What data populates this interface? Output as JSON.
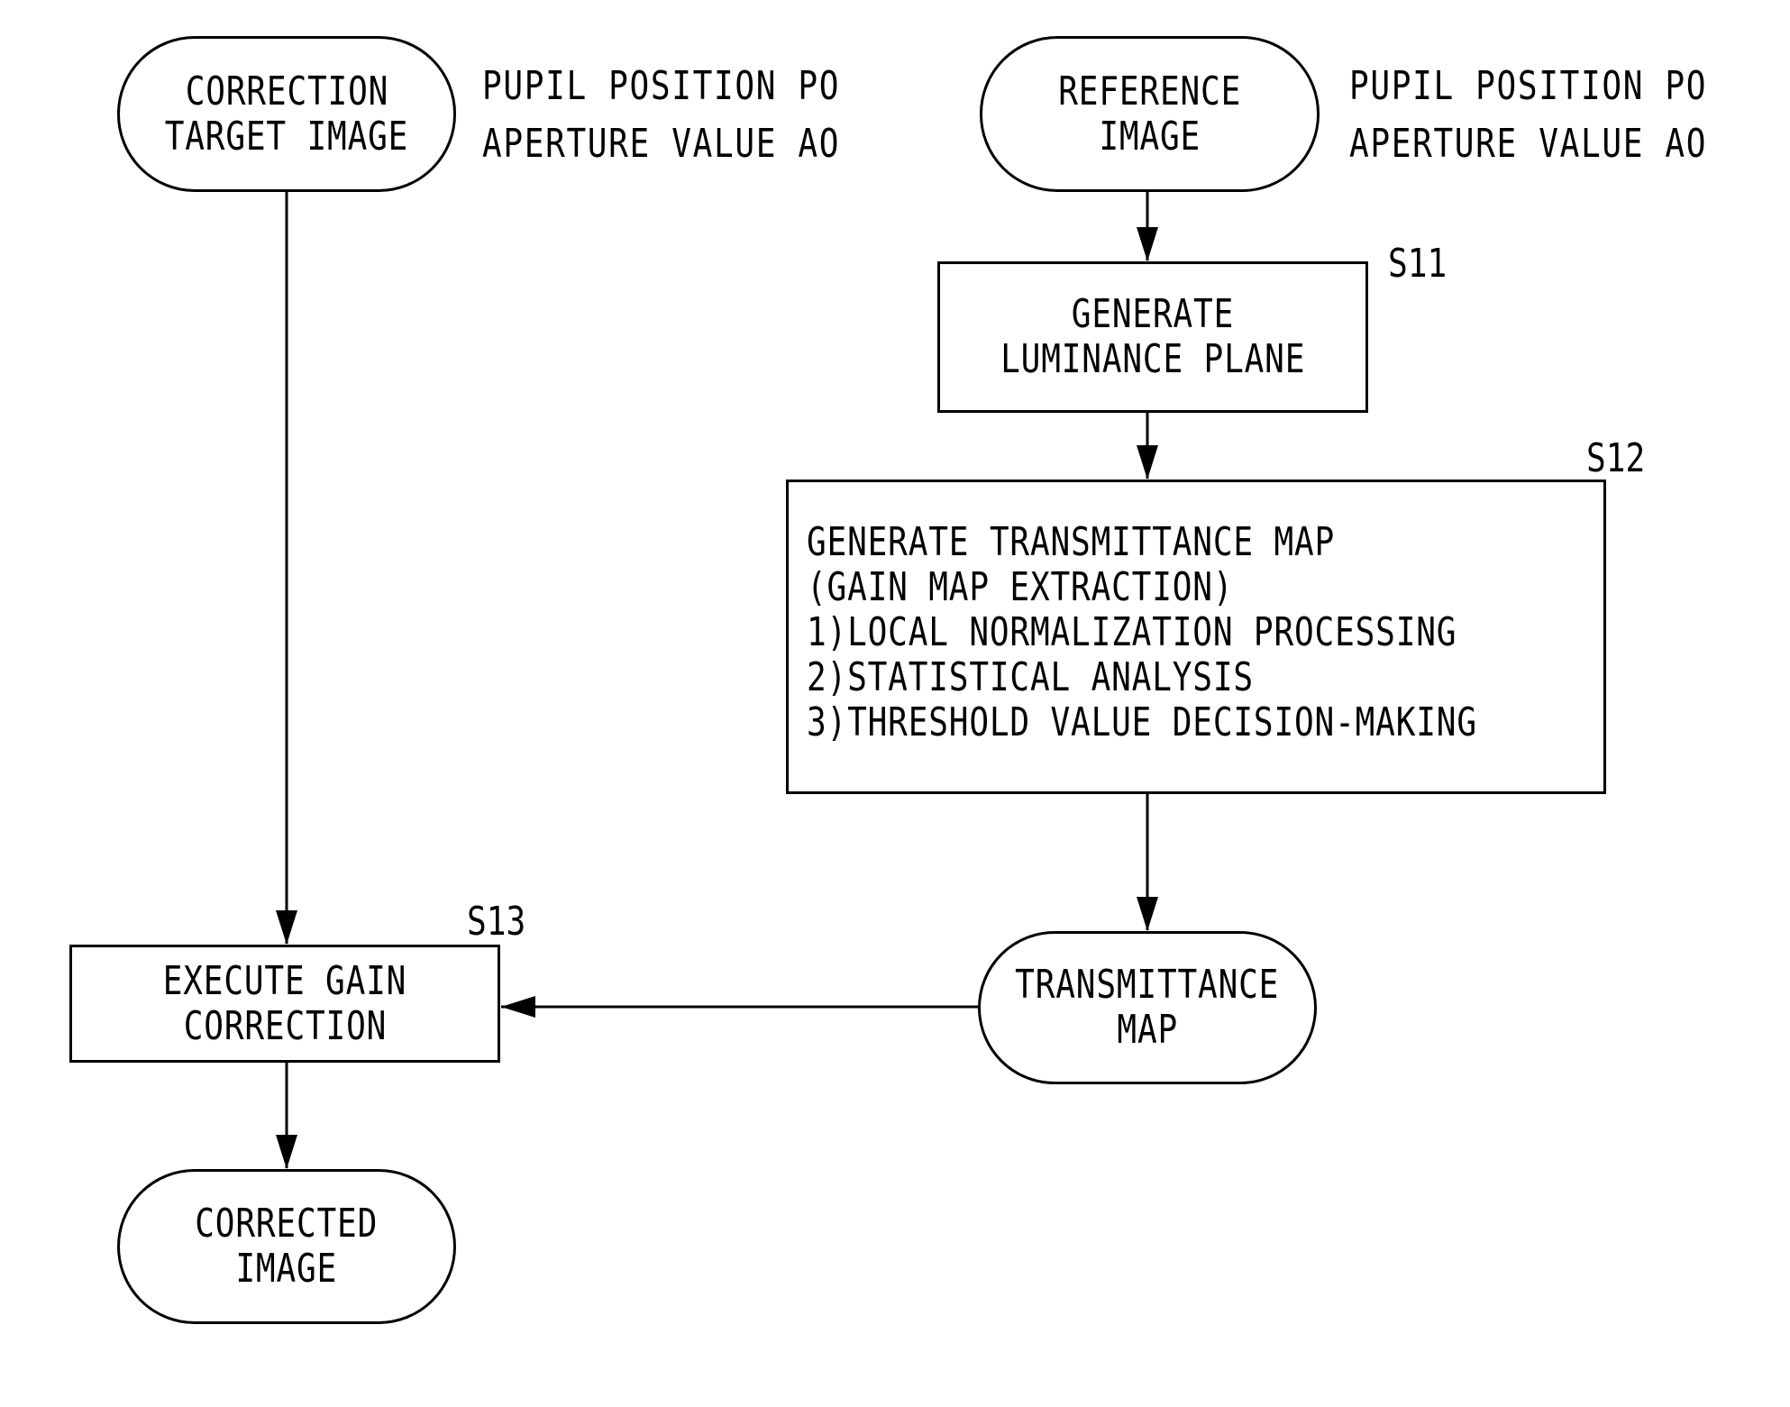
{
  "diagram": {
    "type": "flowchart",
    "nodes": {
      "correction_target_image": {
        "lines": [
          "CORRECTION",
          "TARGET IMAGE"
        ],
        "shape": "terminal"
      },
      "reference_image": {
        "lines": [
          "REFERENCE",
          "IMAGE"
        ],
        "shape": "terminal"
      },
      "generate_luminance_plane": {
        "step": "S11",
        "lines": [
          "GENERATE",
          "LUMINANCE PLANE"
        ],
        "shape": "process"
      },
      "generate_transmittance_map": {
        "step": "S12",
        "lines": [
          "GENERATE TRANSMITTANCE MAP",
          "(GAIN MAP EXTRACTION)",
          "1)LOCAL NORMALIZATION PROCESSING",
          "2)STATISTICAL ANALYSIS",
          "3)THRESHOLD VALUE DECISION-MAKING"
        ],
        "shape": "process"
      },
      "transmittance_map": {
        "lines": [
          "TRANSMITTANCE",
          "MAP"
        ],
        "shape": "terminal"
      },
      "execute_gain_correction": {
        "step": "S13",
        "lines": [
          "EXECUTE GAIN",
          "CORRECTION"
        ],
        "shape": "process"
      },
      "corrected_image": {
        "lines": [
          "CORRECTED",
          "IMAGE"
        ],
        "shape": "terminal"
      }
    },
    "annotations": {
      "correction_target": [
        "PUPIL POSITION PO",
        "APERTURE VALUE AO"
      ],
      "reference": [
        "PUPIL POSITION PO",
        "APERTURE VALUE AO"
      ]
    },
    "edges": [
      {
        "from": "reference_image",
        "to": "generate_luminance_plane"
      },
      {
        "from": "generate_luminance_plane",
        "to": "generate_transmittance_map"
      },
      {
        "from": "generate_transmittance_map",
        "to": "transmittance_map"
      },
      {
        "from": "correction_target_image",
        "to": "execute_gain_correction"
      },
      {
        "from": "transmittance_map",
        "to": "execute_gain_correction"
      },
      {
        "from": "execute_gain_correction",
        "to": "corrected_image"
      }
    ]
  }
}
